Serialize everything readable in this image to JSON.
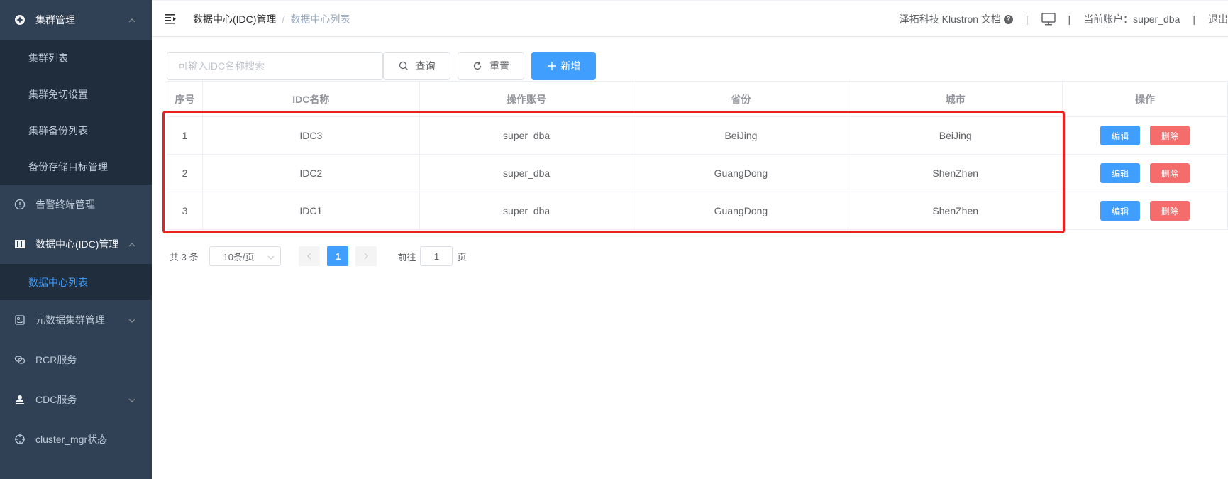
{
  "sidebar": {
    "menus": [
      {
        "label": "集群管理",
        "icon": "cluster-icon",
        "open": true,
        "children": [
          {
            "label": "集群列表"
          },
          {
            "label": "集群免切设置"
          },
          {
            "label": "集群备份列表"
          },
          {
            "label": "备份存储目标管理"
          }
        ]
      },
      {
        "label": "告警终端管理",
        "icon": "alert-circle-icon"
      },
      {
        "label": "数据中心(IDC)管理",
        "icon": "datacenter-icon",
        "open": true,
        "children": [
          {
            "label": "数据中心列表",
            "active": true
          }
        ]
      },
      {
        "label": "元数据集群管理",
        "icon": "metadata-icon"
      },
      {
        "label": "RCR服务",
        "icon": "rcr-icon"
      },
      {
        "label": "CDC服务",
        "icon": "user-icon"
      },
      {
        "label": "cluster_mgr状态",
        "icon": "crosshair-icon"
      }
    ]
  },
  "header": {
    "breadcrumb": [
      "数据中心(IDC)管理",
      "数据中心列表"
    ],
    "docs_link": "泽拓科技 Klustron 文档",
    "account_label": "当前账户：super_dba",
    "logout_label": "退出"
  },
  "toolbar": {
    "search_placeholder": "可输入IDC名称搜索",
    "search_value": "",
    "search_label": "查询",
    "reset_label": "重置",
    "add_label": "新增"
  },
  "table": {
    "columns": [
      "序号",
      "IDC名称",
      "操作账号",
      "省份",
      "城市",
      "操作"
    ],
    "rows": [
      {
        "index": "1",
        "name": "IDC3",
        "account": "super_dba",
        "province": "BeiJing",
        "city": "BeiJing"
      },
      {
        "index": "2",
        "name": "IDC2",
        "account": "super_dba",
        "province": "GuangDong",
        "city": "ShenZhen"
      },
      {
        "index": "3",
        "name": "IDC1",
        "account": "super_dba",
        "province": "GuangDong",
        "city": "ShenZhen"
      }
    ],
    "edit_label": "编辑",
    "delete_label": "删除"
  },
  "pagination": {
    "total_label": "共 3 条",
    "page_size": "10条/页",
    "current_page": "1",
    "goto_prefix": "前往",
    "goto_value": "1",
    "goto_suffix": "页"
  },
  "colors": {
    "sidebar_bg": "#304156",
    "submenu_bg": "#1f2d3d",
    "primary": "#409eff",
    "danger": "#f56c6c",
    "highlight": "#e8231f"
  }
}
